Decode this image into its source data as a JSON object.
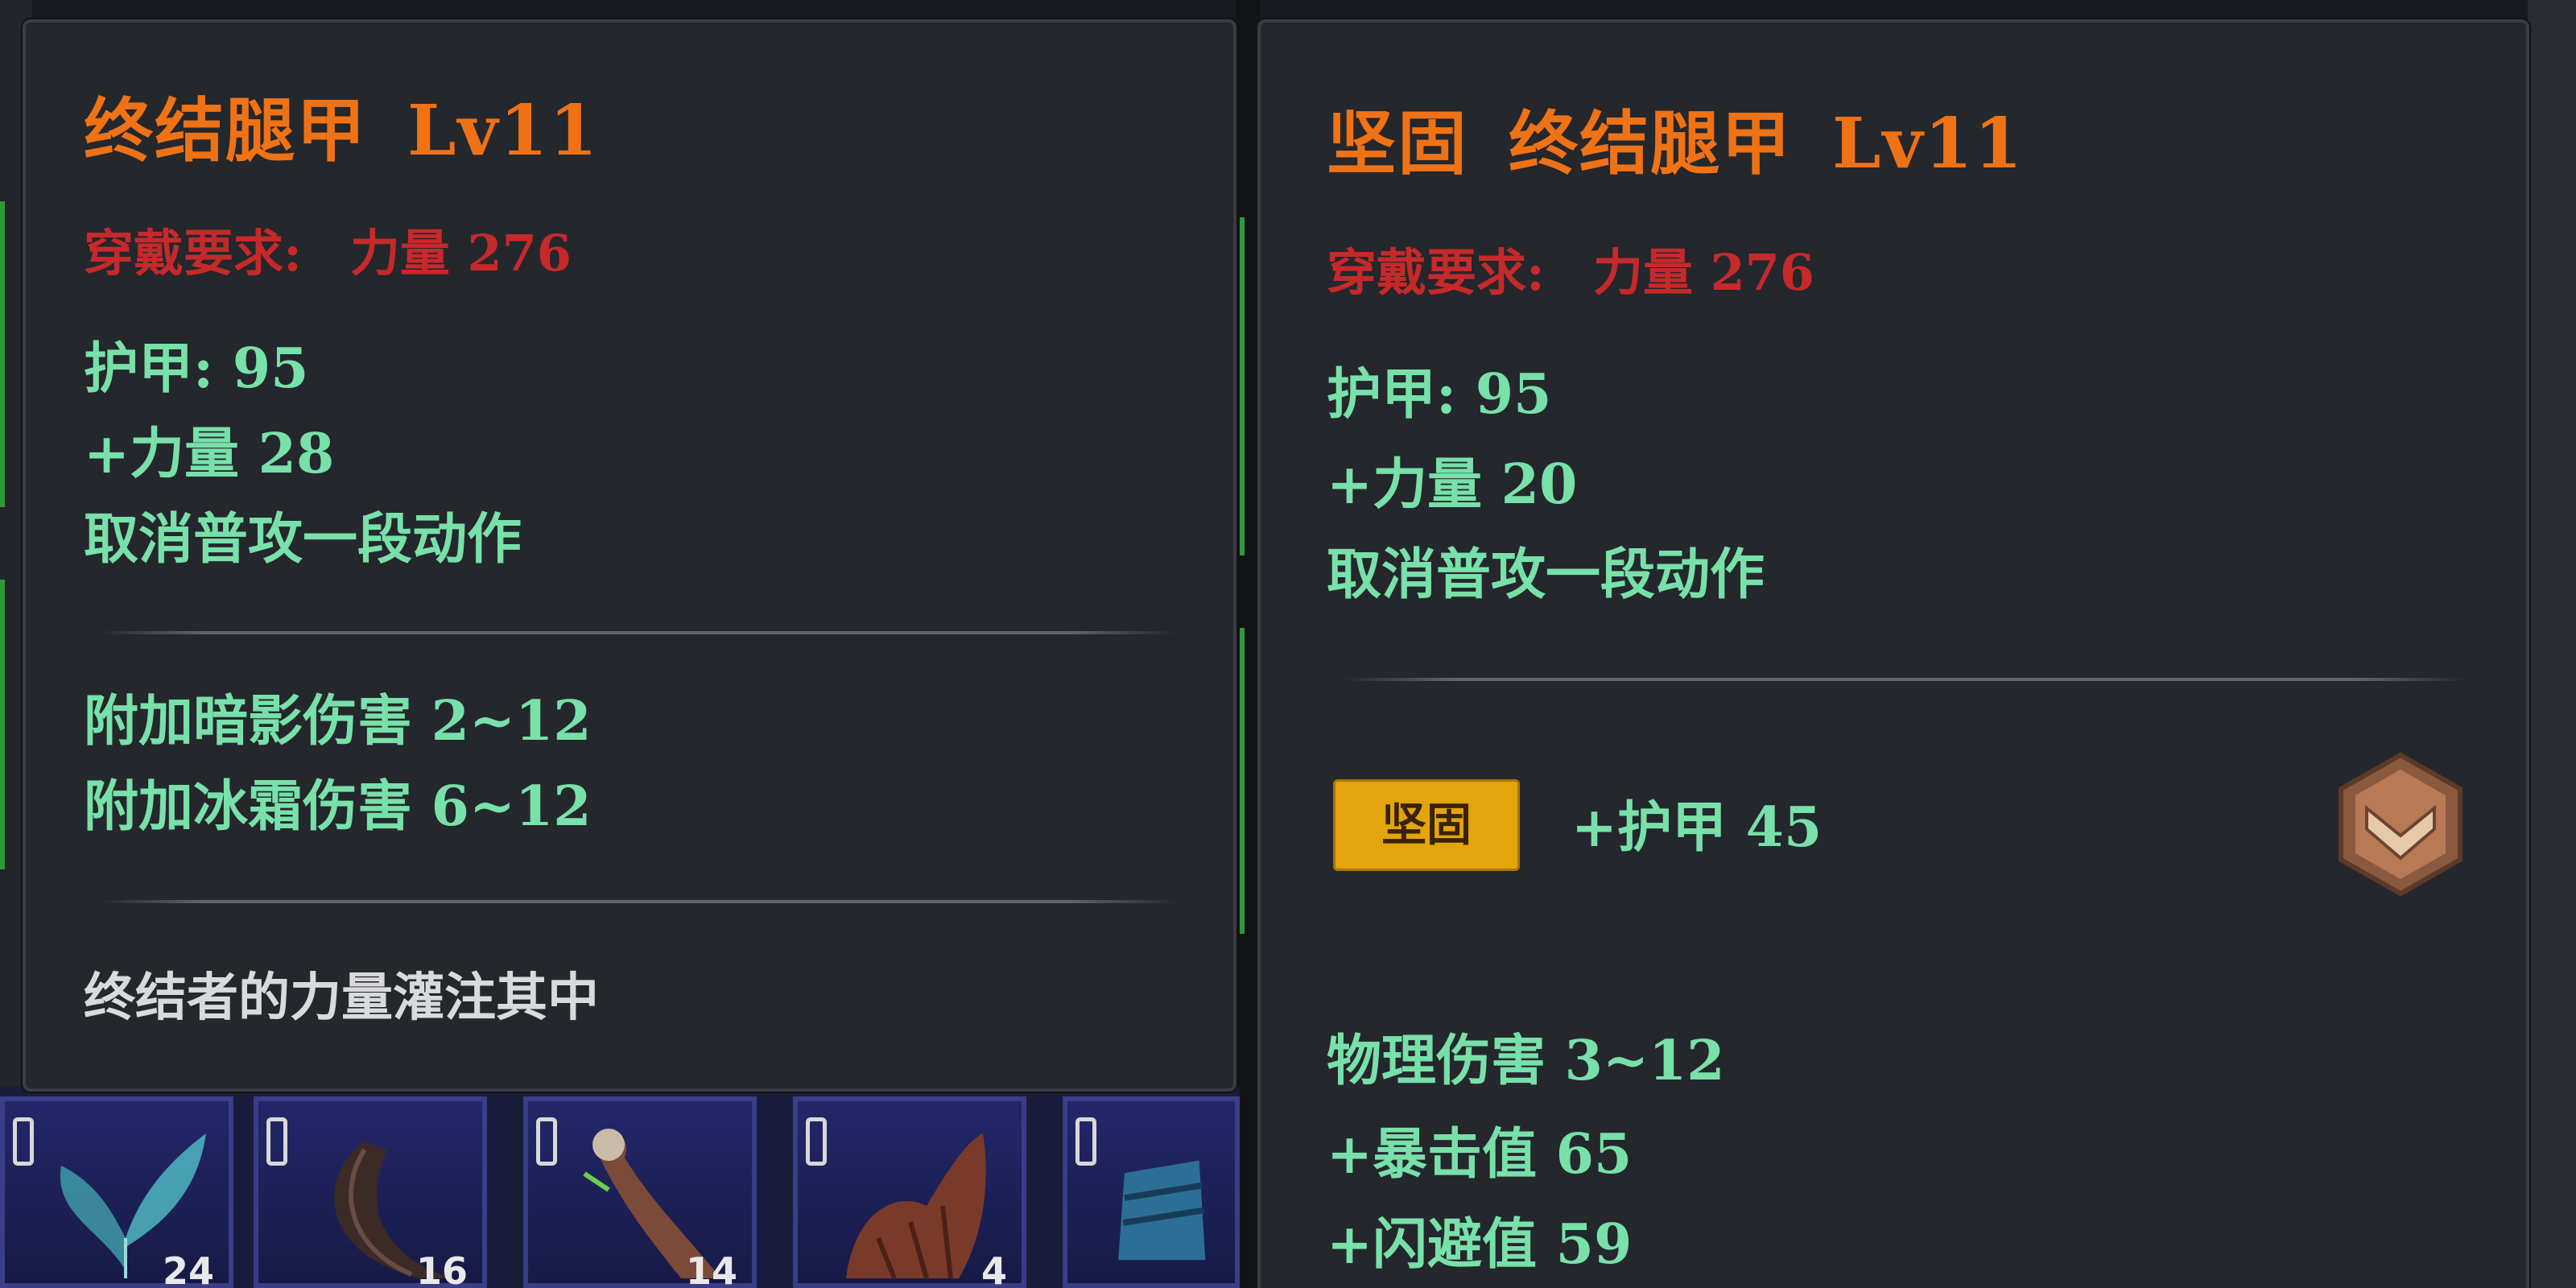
{
  "left_tooltip": {
    "title_name": "终结腿甲",
    "title_level": "Lv11",
    "requirement_label": "穿戴要求:",
    "requirement_value": "力量 276",
    "stats": [
      "护甲: 95",
      "+力量 28",
      "取消普攻一段动作"
    ],
    "elemental_damage": [
      "附加暗影伤害 2~12",
      "附加冰霜伤害 6~12"
    ],
    "flavor_text": "终结者的力量灌注其中"
  },
  "right_tooltip": {
    "title_prefix": "坚固",
    "title_name": "终结腿甲",
    "title_level": "Lv11",
    "requirement_label": "穿戴要求:",
    "requirement_value": "力量 276",
    "stats": [
      "护甲: 95",
      "+力量 20",
      "取消普攻一段动作"
    ],
    "affix_badge": "坚固",
    "affix_bonus": "+护甲 45",
    "extra_stats": [
      "物理伤害 3~12",
      "+暴击值 65",
      "+闪避值 59"
    ],
    "rank_icon": "chevron-rank-icon"
  },
  "inventory": {
    "slots": [
      {
        "icon": "butterfly-wing-icon",
        "count": "24"
      },
      {
        "icon": "horn-icon",
        "count": "16"
      },
      {
        "icon": "claw-icon",
        "count": "14"
      },
      {
        "icon": "beast-tail-icon",
        "count": "4"
      },
      {
        "icon": "blue-armor-icon",
        "count": ""
      }
    ]
  },
  "colors": {
    "title": "#ef7215",
    "requirement": "#c5292a",
    "stat": "#78e0a9",
    "flavor": "#d9dadc",
    "badge": "#e3a50b",
    "panel_bg": "#24272c"
  }
}
